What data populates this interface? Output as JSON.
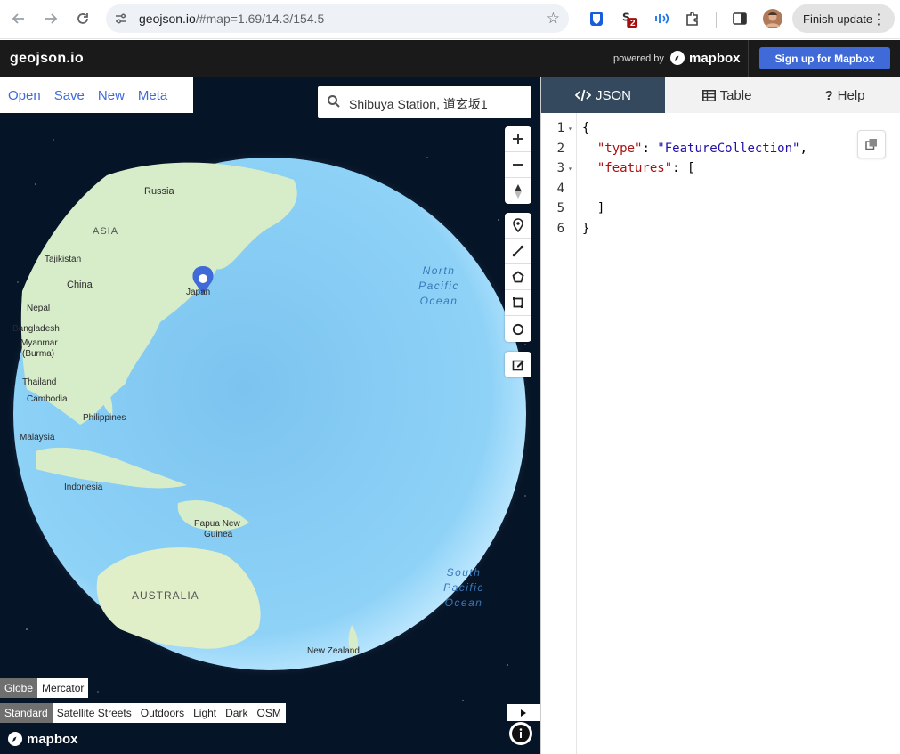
{
  "browser": {
    "url_host": "geojson.io",
    "url_path": "/#map=1.69/14.3/154.5",
    "finish_update_label": "Finish update",
    "ext_badge": "2"
  },
  "header": {
    "brand": "geojson.io",
    "powered_by": "powered by",
    "mapbox_logo": "mapbox",
    "signup_label": "Sign up for Mapbox"
  },
  "map": {
    "menu": [
      "Open",
      "Save",
      "New",
      "Meta"
    ],
    "search_value": "Shibuya Station, 道玄坂1",
    "labels": {
      "russia": "Russia",
      "asia": "ASIA",
      "tajikistan": "Tajikistan",
      "china": "China",
      "japan": "Japan",
      "nepal": "Nepal",
      "bangladesh": "Bangladesh",
      "myanmar": "Myanmar",
      "burma": "(Burma)",
      "thailand": "Thailand",
      "cambodia": "Cambodia",
      "philippines": "Philippines",
      "malaysia": "Malaysia",
      "indonesia": "Indonesia",
      "png1": "Papua New",
      "png2": "Guinea",
      "australia": "AUSTRALIA",
      "new_zealand": "New Zealand",
      "np1": "North",
      "np2": "Pacific",
      "np3": "Ocean",
      "sp1": "South",
      "sp2": "Pacific",
      "sp3": "Ocean"
    },
    "projections": [
      "Globe",
      "Mercator"
    ],
    "active_projection": "Globe",
    "styles": [
      "Standard",
      "Satellite Streets",
      "Outdoors",
      "Light",
      "Dark",
      "OSM"
    ],
    "active_style": "Standard",
    "watermark": "mapbox"
  },
  "panel": {
    "tabs": [
      {
        "label": "JSON",
        "icon": "code-icon"
      },
      {
        "label": "Table",
        "icon": "table-icon"
      },
      {
        "label": "Help",
        "icon": "question-icon"
      }
    ],
    "active_tab": "JSON",
    "code_lines": {
      "l1": "{",
      "l2_key": "\"type\"",
      "l2_val": "\"FeatureCollection\"",
      "l3_key": "\"features\"",
      "l5": "  ]",
      "l6": "}"
    },
    "line_numbers": [
      "1",
      "2",
      "3",
      "4",
      "5",
      "6"
    ]
  },
  "colors": {
    "header_bg": "#1a1a1a",
    "accent": "#3f6ad8",
    "active_tab": "#34495e",
    "space": "#061427",
    "ocean": "#8fd0f5",
    "land": "#cfe8c0",
    "marker": "#3f6ad8"
  }
}
